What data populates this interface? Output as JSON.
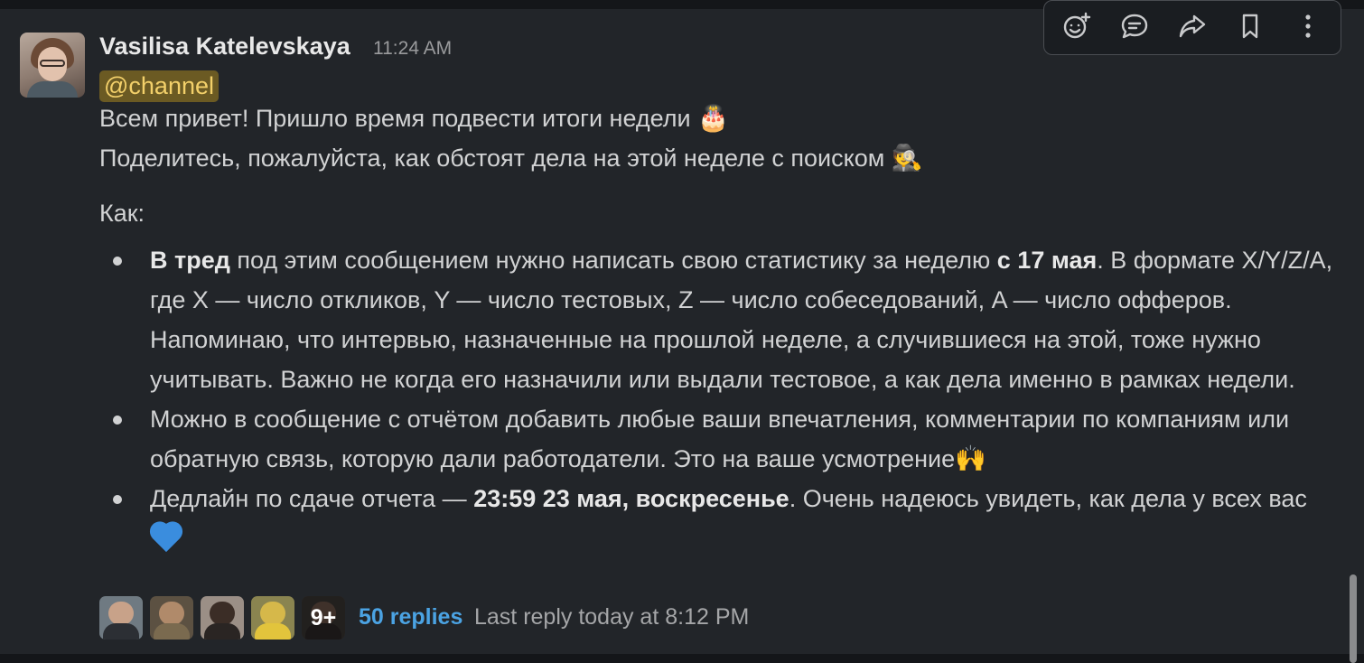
{
  "message": {
    "sender": "Vasilisa Katelevskaya",
    "time": "11:24 AM",
    "mention": "@channel",
    "line1": "Всем привет! Пришло время подвести итоги недели",
    "line1_emoji": "🎂",
    "line2": "Поделитесь, пожалуйста, как обстоят дела на этой неделе с поиском",
    "line2_emoji": "🕵️",
    "how_label": "Как:",
    "bullets": [
      {
        "b1": "В тред",
        "t1": " под этим сообщением нужно написать свою статистику за неделю ",
        "b2": "с 17 мая",
        "t2": ". В формате X/Y/Z/A, где X — число откликов, Y — число тестовых, Z — число собеседований, A — число офферов. Напоминаю, что интервью, назначенные на прошлой неделе, а случившиеся на этой, тоже нужно учитывать. Важно не когда его назначили или выдали тестовое, а как дела именно в рамках недели."
      },
      {
        "t1": "Можно в сообщение с отчётом добавить любые ваши впечатления, комментарии по компаниям или обратную связь, которую дали работодатели. Это на ваше усмотрение",
        "emoji": "🙌"
      },
      {
        "t1": "Дедлайн по сдаче отчета — ",
        "b1": "23:59 23 мая, воскресенье",
        "t2": ". Очень надеюсь увидеть, как дела у всех вас"
      }
    ]
  },
  "thread": {
    "more_count": "9+",
    "replies": "50 replies",
    "last_reply": "Last reply today at 8:12 PM"
  },
  "toolbar": {
    "icons": [
      "add-reaction-icon",
      "reply-in-thread-icon",
      "share-icon",
      "bookmark-icon",
      "more-actions-icon"
    ]
  },
  "colors": {
    "background": "#222529",
    "mention_bg": "#6b5a23",
    "mention_text": "#f3d06a",
    "link": "#4ba3e3",
    "heart": "#3a8dde"
  }
}
